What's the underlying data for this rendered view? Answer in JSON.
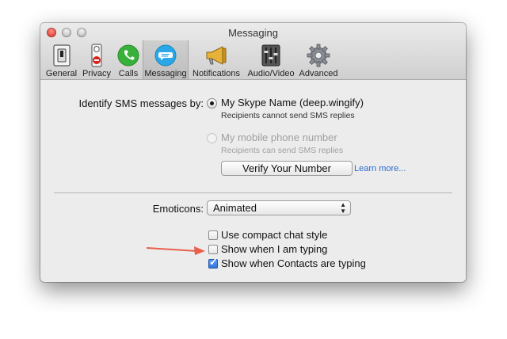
{
  "window": {
    "title": "Messaging"
  },
  "toolbar": {
    "items": [
      {
        "label": "General",
        "icon": "general-icon",
        "selected": false
      },
      {
        "label": "Privacy",
        "icon": "privacy-icon",
        "selected": false
      },
      {
        "label": "Calls",
        "icon": "calls-icon",
        "selected": false
      },
      {
        "label": "Messaging",
        "icon": "messaging-icon",
        "selected": true
      },
      {
        "label": "Notifications",
        "icon": "megaphone-icon",
        "selected": false
      },
      {
        "label": "Audio/Video",
        "icon": "mixer-icon",
        "selected": false
      },
      {
        "label": "Advanced",
        "icon": "gear-icon",
        "selected": false
      }
    ]
  },
  "sms": {
    "label": "Identify SMS messages by:",
    "option1": {
      "label": "My Skype Name (deep.wingify)",
      "sub": "Recipients cannot send SMS replies",
      "selected": true
    },
    "option2": {
      "label": "My mobile phone number",
      "sub": "Recipients can send SMS replies",
      "selected": false,
      "disabled": true
    },
    "verify_button": "Verify Your Number",
    "learn_more": "Learn more..."
  },
  "emoticons": {
    "label": "Emoticons:",
    "value": "Animated"
  },
  "checkboxes": [
    {
      "label": "Use compact chat style",
      "checked": false
    },
    {
      "label": "Show when I am typing",
      "checked": false
    },
    {
      "label": "Show when Contacts are typing",
      "checked": true
    }
  ],
  "colors": {
    "accent": "#2f72d8",
    "arrow": "#e8604c",
    "link": "#2a6ad6"
  }
}
